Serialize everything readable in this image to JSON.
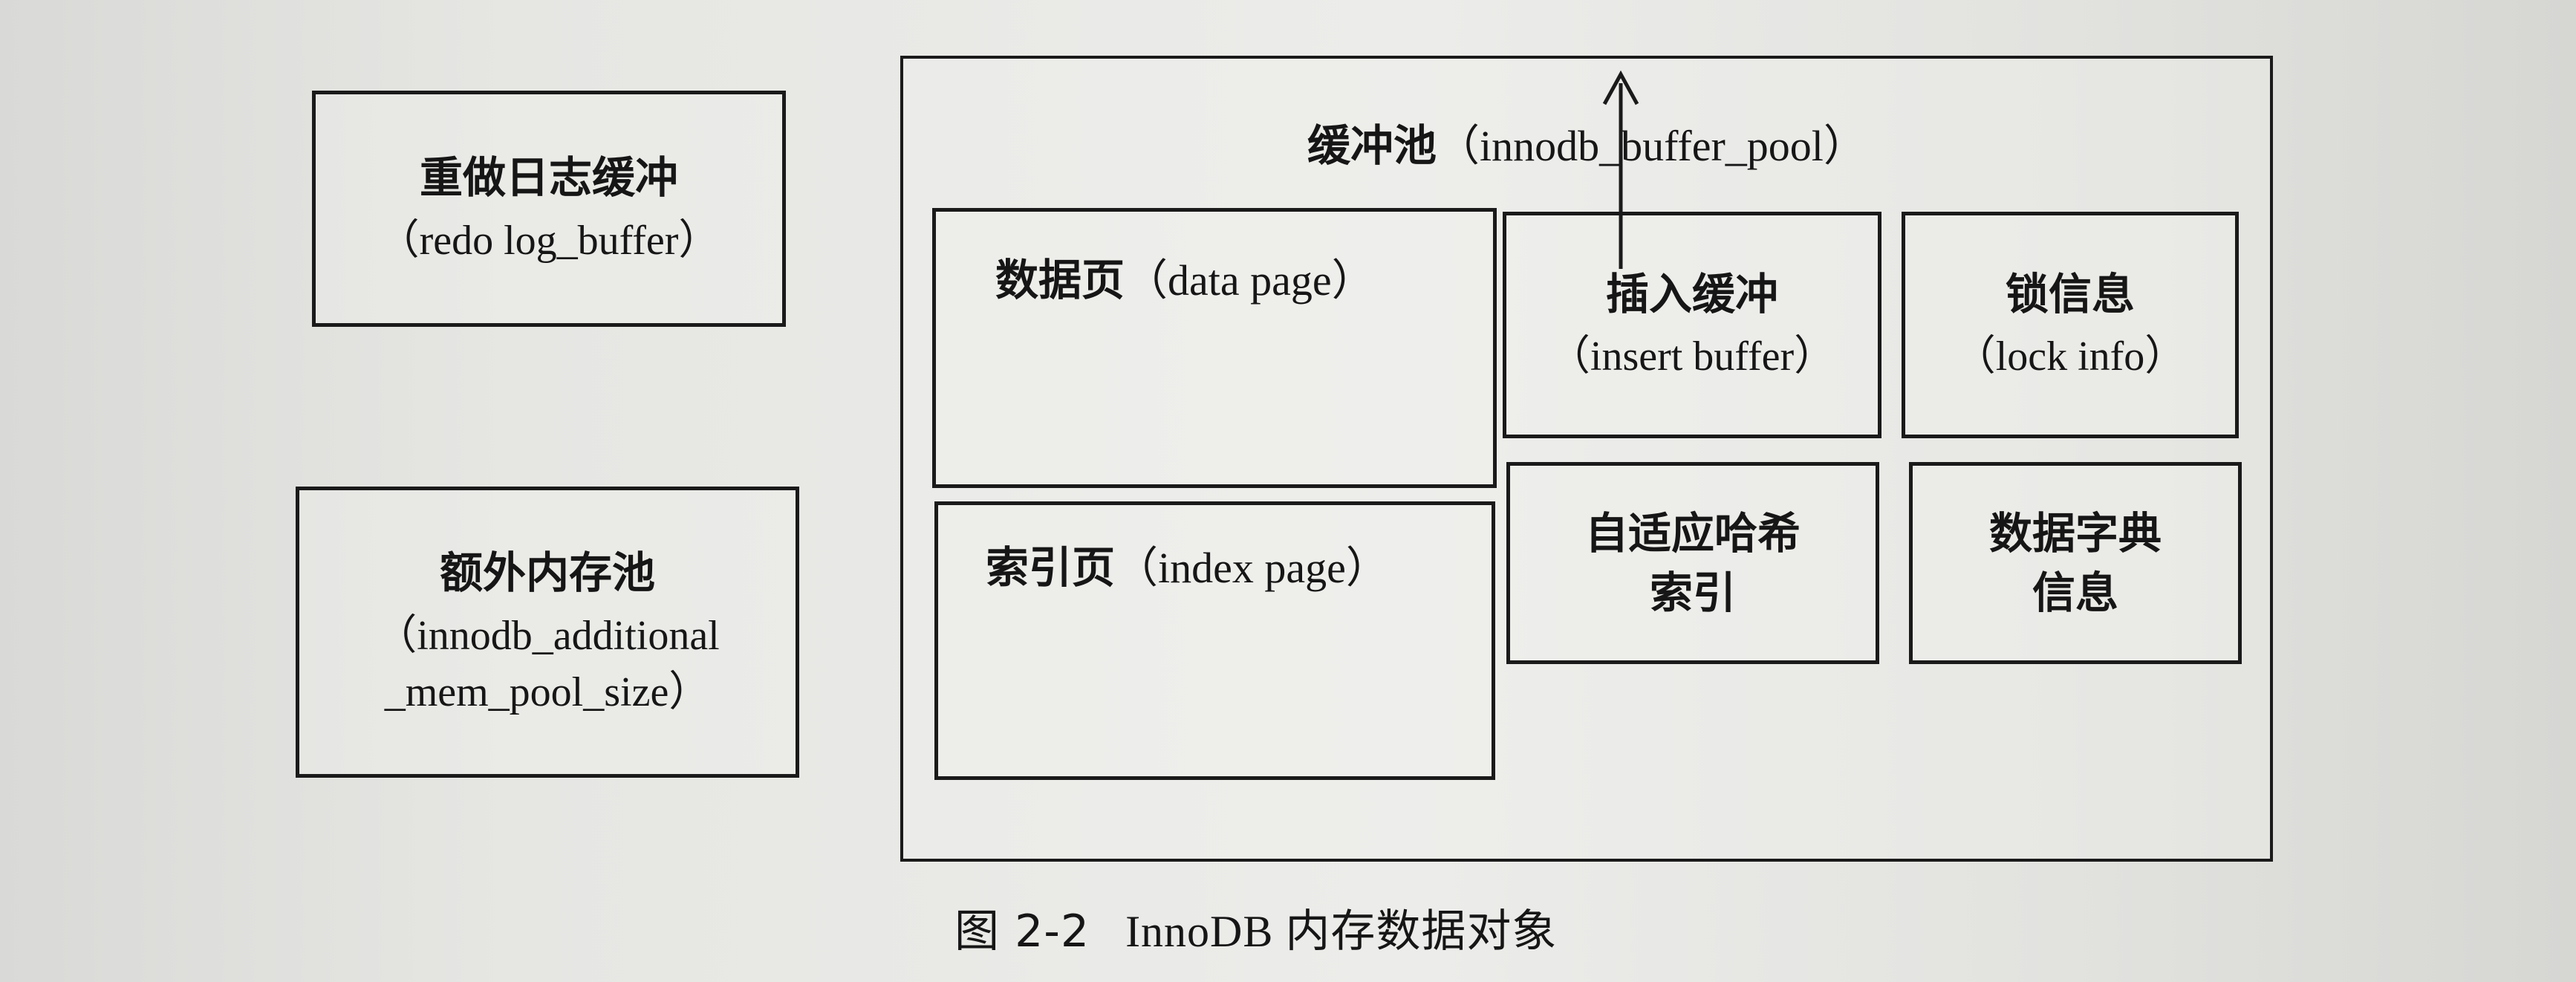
{
  "diagram": {
    "redo_log_buffer": {
      "title": "重做日志缓冲",
      "subtitle": "（redo log_buffer）"
    },
    "additional_mem_pool": {
      "title": "额外内存池",
      "line1": "（innodb_additional",
      "line2": "_mem_pool_size）"
    },
    "buffer_pool": {
      "title": "缓冲池",
      "subtitle": "（innodb_buffer_pool）",
      "data_page": {
        "title": "数据页",
        "subtitle": "（data page）"
      },
      "index_page": {
        "title": "索引页",
        "subtitle": "（index page）"
      },
      "insert_buffer": {
        "title": "插入缓冲",
        "subtitle": "（insert buffer）"
      },
      "lock_info": {
        "title": "锁信息",
        "subtitle": "（lock info）"
      },
      "adaptive_hash_index": {
        "line1": "自适应哈希",
        "line2": "索引"
      },
      "data_dictionary": {
        "line1": "数据字典",
        "line2": "信息"
      }
    },
    "caption": {
      "figure_number": "图 2-2",
      "title_en": "InnoDB",
      "title_cn": "内存数据对象"
    }
  }
}
